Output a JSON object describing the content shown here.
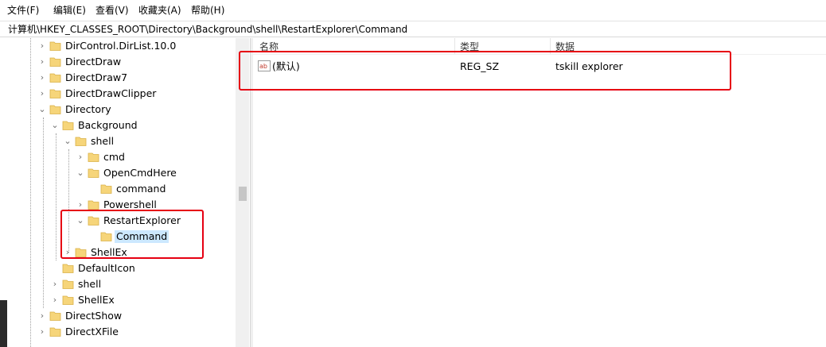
{
  "menu": [
    "文件(F)",
    "编辑(E)",
    "查看(V)",
    "收藏夹(A)",
    "帮助(H)"
  ],
  "address": "计算机\\HKEY_CLASSES_ROOT\\Directory\\Background\\shell\\RestartExplorer\\Command",
  "tree": {
    "items": [
      {
        "label": "DirControl.DirList.10.0",
        "expanded": false
      },
      {
        "label": "DirectDraw",
        "expanded": false
      },
      {
        "label": "DirectDraw7",
        "expanded": false
      },
      {
        "label": "DirectDrawClipper",
        "expanded": false
      },
      {
        "label": "Directory",
        "expanded": true
      },
      {
        "label": "Background",
        "expanded": true
      },
      {
        "label": "shell",
        "expanded": true
      },
      {
        "label": "cmd",
        "expanded": false
      },
      {
        "label": "OpenCmdHere",
        "expanded": true
      },
      {
        "label": "command",
        "expanded": null
      },
      {
        "label": "Powershell",
        "expanded": false
      },
      {
        "label": "RestartExplorer",
        "expanded": true
      },
      {
        "label": "Command",
        "expanded": null,
        "selected": true
      },
      {
        "label": "ShellEx",
        "expanded": false
      },
      {
        "label": "DefaultIcon",
        "expanded": null
      },
      {
        "label": "shell",
        "expanded": false
      },
      {
        "label": "ShellEx",
        "expanded": false
      },
      {
        "label": "DirectShow",
        "expanded": false
      },
      {
        "label": "DirectXFile",
        "expanded": false
      }
    ]
  },
  "list": {
    "columns": [
      "名称",
      "类型",
      "数据"
    ],
    "rows": [
      {
        "name": "(默认)",
        "type": "REG_SZ",
        "data": "tskill explorer",
        "icon": "string-value-icon"
      }
    ]
  },
  "colors": {
    "highlight": "#e60012",
    "selection": "#cce8ff",
    "folder": "#f6d57a"
  }
}
